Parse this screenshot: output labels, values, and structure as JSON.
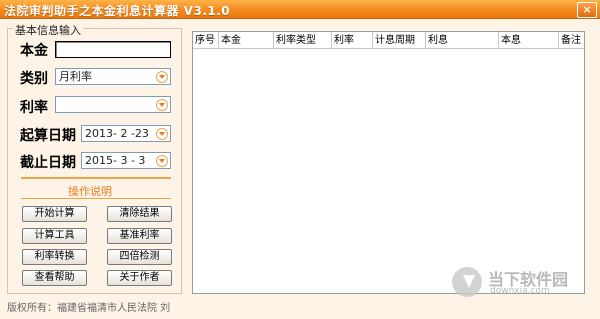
{
  "window": {
    "title": "法院审判助手之本金利息计算器 V3.1.0",
    "close_label": "×"
  },
  "input_group": {
    "legend": "基本信息输入",
    "principal": {
      "label": "本金",
      "value": ""
    },
    "type": {
      "label": "类别",
      "value": "月利率"
    },
    "rate": {
      "label": "利率",
      "value": ""
    },
    "start_date": {
      "label": "起算日期",
      "value": "2013- 2 -23"
    },
    "end_date": {
      "label": "截止日期",
      "value": "2015- 3 - 3"
    }
  },
  "operations": {
    "title": "操作说明",
    "buttons": {
      "start_calc": "开始计算",
      "clear_results": "清除结果",
      "calc_tools": "计算工具",
      "base_rate": "基准利率",
      "rate_convert": "利率转换",
      "quadruple_check": "四倍检测",
      "view_help": "查看帮助",
      "about_author": "关于作者"
    }
  },
  "results_table": {
    "columns": [
      "序号",
      "本金",
      "利率类型",
      "利率",
      "计息周期",
      "利息",
      "本息",
      "备注"
    ]
  },
  "footer": {
    "copyright": "版权所有：福建省福清市人民法院 刘"
  },
  "watermark": {
    "name": "当下软件园",
    "site": "downxia.com"
  },
  "colors": {
    "titlebar": "#f58a1f",
    "accent": "#e87d1e",
    "background": "#fdf3e7"
  }
}
